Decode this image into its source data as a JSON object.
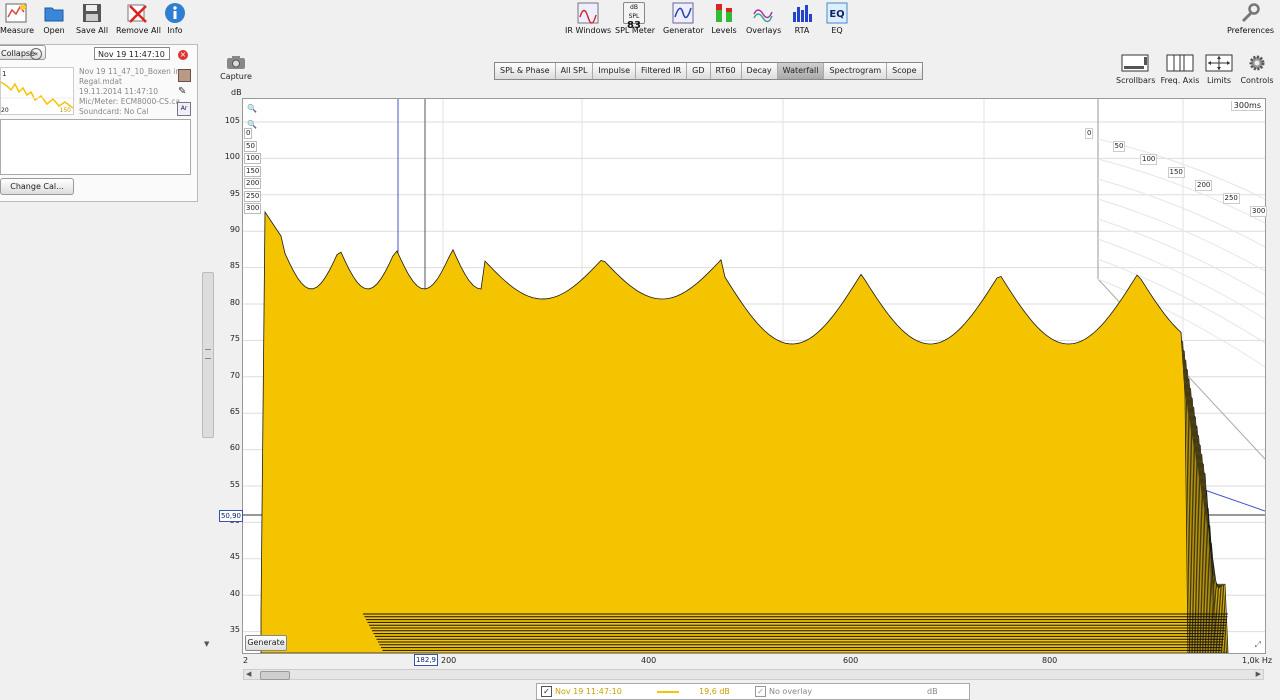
{
  "toolbar_left": [
    {
      "label": "Measure",
      "icon": "measure-icon"
    },
    {
      "label": "Open",
      "icon": "folder-icon"
    },
    {
      "label": "Save All",
      "icon": "save-icon"
    },
    {
      "label": "Remove All",
      "icon": "remove-all-icon"
    },
    {
      "label": "Info",
      "icon": "info-icon"
    }
  ],
  "toolbar_center": [
    {
      "label": "IR Windows",
      "icon": "ir-windows-icon"
    },
    {
      "label": "SPL Meter",
      "icon": "spl-meter-icon",
      "badge_top": "dB SPL",
      "badge_value": "83"
    },
    {
      "label": "Generator",
      "icon": "generator-icon"
    },
    {
      "label": "Levels",
      "icon": "levels-icon"
    },
    {
      "label": "Overlays",
      "icon": "overlays-icon"
    },
    {
      "label": "RTA",
      "icon": "rta-icon"
    },
    {
      "label": "EQ",
      "icon": "eq-icon"
    }
  ],
  "toolbar_right": {
    "label": "Preferences",
    "icon": "wrench-icon"
  },
  "left_panel": {
    "collapse_label": "Collapse",
    "measurement_name": "Nov 19 11:47:10",
    "info_lines": [
      "Nov 19 11_47_10_Boxen in",
      "Regal.mdat",
      "19.11.2014 11:47:10",
      "Mic/Meter: ECM8000-CS.ca",
      "Soundcard: No Cal"
    ],
    "thumb_label_y": "1",
    "thumb_label_x": "20",
    "thumb_label_x2": "150",
    "change_cal_label": "Change Cal..."
  },
  "capture_label": "Capture",
  "tabs": [
    {
      "label": "SPL & Phase",
      "active": false
    },
    {
      "label": "All SPL",
      "active": false
    },
    {
      "label": "Impulse",
      "active": false
    },
    {
      "label": "Filtered IR",
      "active": false
    },
    {
      "label": "GD",
      "active": false
    },
    {
      "label": "RT60",
      "active": false
    },
    {
      "label": "Decay",
      "active": false
    },
    {
      "label": "Waterfall",
      "active": true
    },
    {
      "label": "Spectrogram",
      "active": false
    },
    {
      "label": "Scope",
      "active": false
    }
  ],
  "right_controls": [
    {
      "label": "Scrollbars",
      "icon": "scrollbars-icon"
    },
    {
      "label": "Freq. Axis",
      "icon": "freq-axis-icon"
    },
    {
      "label": "Limits",
      "icon": "limits-icon"
    },
    {
      "label": "Controls",
      "icon": "gear-icon"
    }
  ],
  "graph": {
    "y_unit": "dB",
    "y_ticks": [
      "105",
      "100",
      "95",
      "90",
      "85",
      "80",
      "75",
      "70",
      "65",
      "60",
      "55",
      "50",
      "45",
      "40",
      "35"
    ],
    "x_ticks": [
      "2",
      "200",
      "400",
      "600",
      "800",
      "1,0k Hz"
    ],
    "cursor_value": "50,90",
    "cursor_freq": "182,9",
    "time_label": "300ms",
    "z_ticks_right": [
      "0",
      "50",
      "100",
      "150",
      "200",
      "250",
      "300"
    ],
    "z_ticks_left": [
      "0",
      "50",
      "100",
      "150",
      "200",
      "250",
      "300"
    ],
    "generate_label": "Generate",
    "fill_color": "#f5c400"
  },
  "legend": {
    "measurement": "Nov 19 11:47:10",
    "value": "19,6 dB",
    "overlay": "No overlay",
    "overlay_unit": "dB",
    "color": "#f5c400"
  }
}
